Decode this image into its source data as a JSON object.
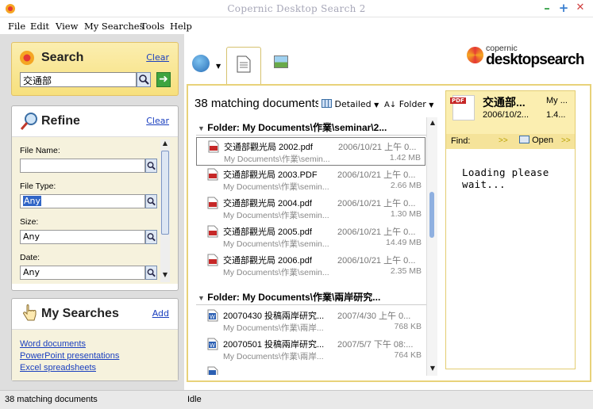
{
  "window": {
    "title": "Copernic Desktop Search 2"
  },
  "menu": [
    "File",
    "Edit",
    "View",
    "My Searches",
    "Tools",
    "Help"
  ],
  "search": {
    "title": "Search",
    "clear_label": "Clear",
    "query": "交通部"
  },
  "refine": {
    "title": "Refine",
    "clear_label": "Clear",
    "fields": [
      {
        "label": "File Name:",
        "value": ""
      },
      {
        "label": "File Type:",
        "value": "Any"
      },
      {
        "label": "Size:",
        "value": "Any"
      },
      {
        "label": "Date:",
        "value": "Any"
      }
    ]
  },
  "my_searches": {
    "title": "My Searches",
    "add_label": "Add",
    "items": [
      "Word documents",
      "PowerPoint presentations",
      "Excel spreadsheets"
    ]
  },
  "logo": {
    "line1": "copernic",
    "line2": "desktopsearch"
  },
  "results": {
    "header": "38 matching documents",
    "view_label": "Detailed",
    "group_label": "Folder",
    "groups": [
      {
        "label": "Folder: My Documents\\作業\\seminar\\2...",
        "rows": [
          {
            "name": "交通部觀光局 2002.pdf",
            "date": "2006/10/21 上午 0...",
            "path": "My Documents\\作業\\semin...",
            "size": "1.42 MB",
            "icon": "pdf-icon",
            "selected": true
          },
          {
            "name": "交通部觀光局 2003.PDF",
            "date": "2006/10/21 上午 0...",
            "path": "My Documents\\作業\\semin...",
            "size": "2.66 MB",
            "icon": "pdf-icon",
            "selected": false
          },
          {
            "name": "交通部觀光局 2004.pdf",
            "date": "2006/10/21 上午 0...",
            "path": "My Documents\\作業\\semin...",
            "size": "1.30 MB",
            "icon": "pdf-icon",
            "selected": false
          },
          {
            "name": "交通部觀光局 2005.pdf",
            "date": "2006/10/21 上午 0...",
            "path": "My Documents\\作業\\semin...",
            "size": "14.49 MB",
            "icon": "pdf-icon",
            "selected": false
          },
          {
            "name": "交通部觀光局 2006.pdf",
            "date": "2006/10/21 上午 0...",
            "path": "My Documents\\作業\\semin...",
            "size": "2.35 MB",
            "icon": "pdf-icon",
            "selected": false
          }
        ]
      },
      {
        "label": "Folder: My Documents\\作業\\兩岸研究...",
        "rows": [
          {
            "name": "20070430 投稿兩岸研究...",
            "date": "2007/4/30 上午 0...",
            "path": "My Documents\\作業\\兩岸...",
            "size": "768 KB",
            "icon": "word-doc-icon",
            "selected": false
          },
          {
            "name": "20070501 投稿兩岸研究...",
            "date": "2007/5/7 下午 08:...",
            "path": "My Documents\\作業\\兩岸...",
            "size": "764 KB",
            "icon": "word-doc-icon",
            "selected": false
          }
        ]
      }
    ]
  },
  "preview": {
    "title": "交通部...",
    "date": "2006/10/2...",
    "col2_top": "My ...",
    "col2_bottom": "1.4...",
    "find_label": "Find:",
    "open_label": "Open",
    "loading": "Loading please wait..."
  },
  "status": {
    "count": "38 matching documents",
    "state": "Idle"
  }
}
